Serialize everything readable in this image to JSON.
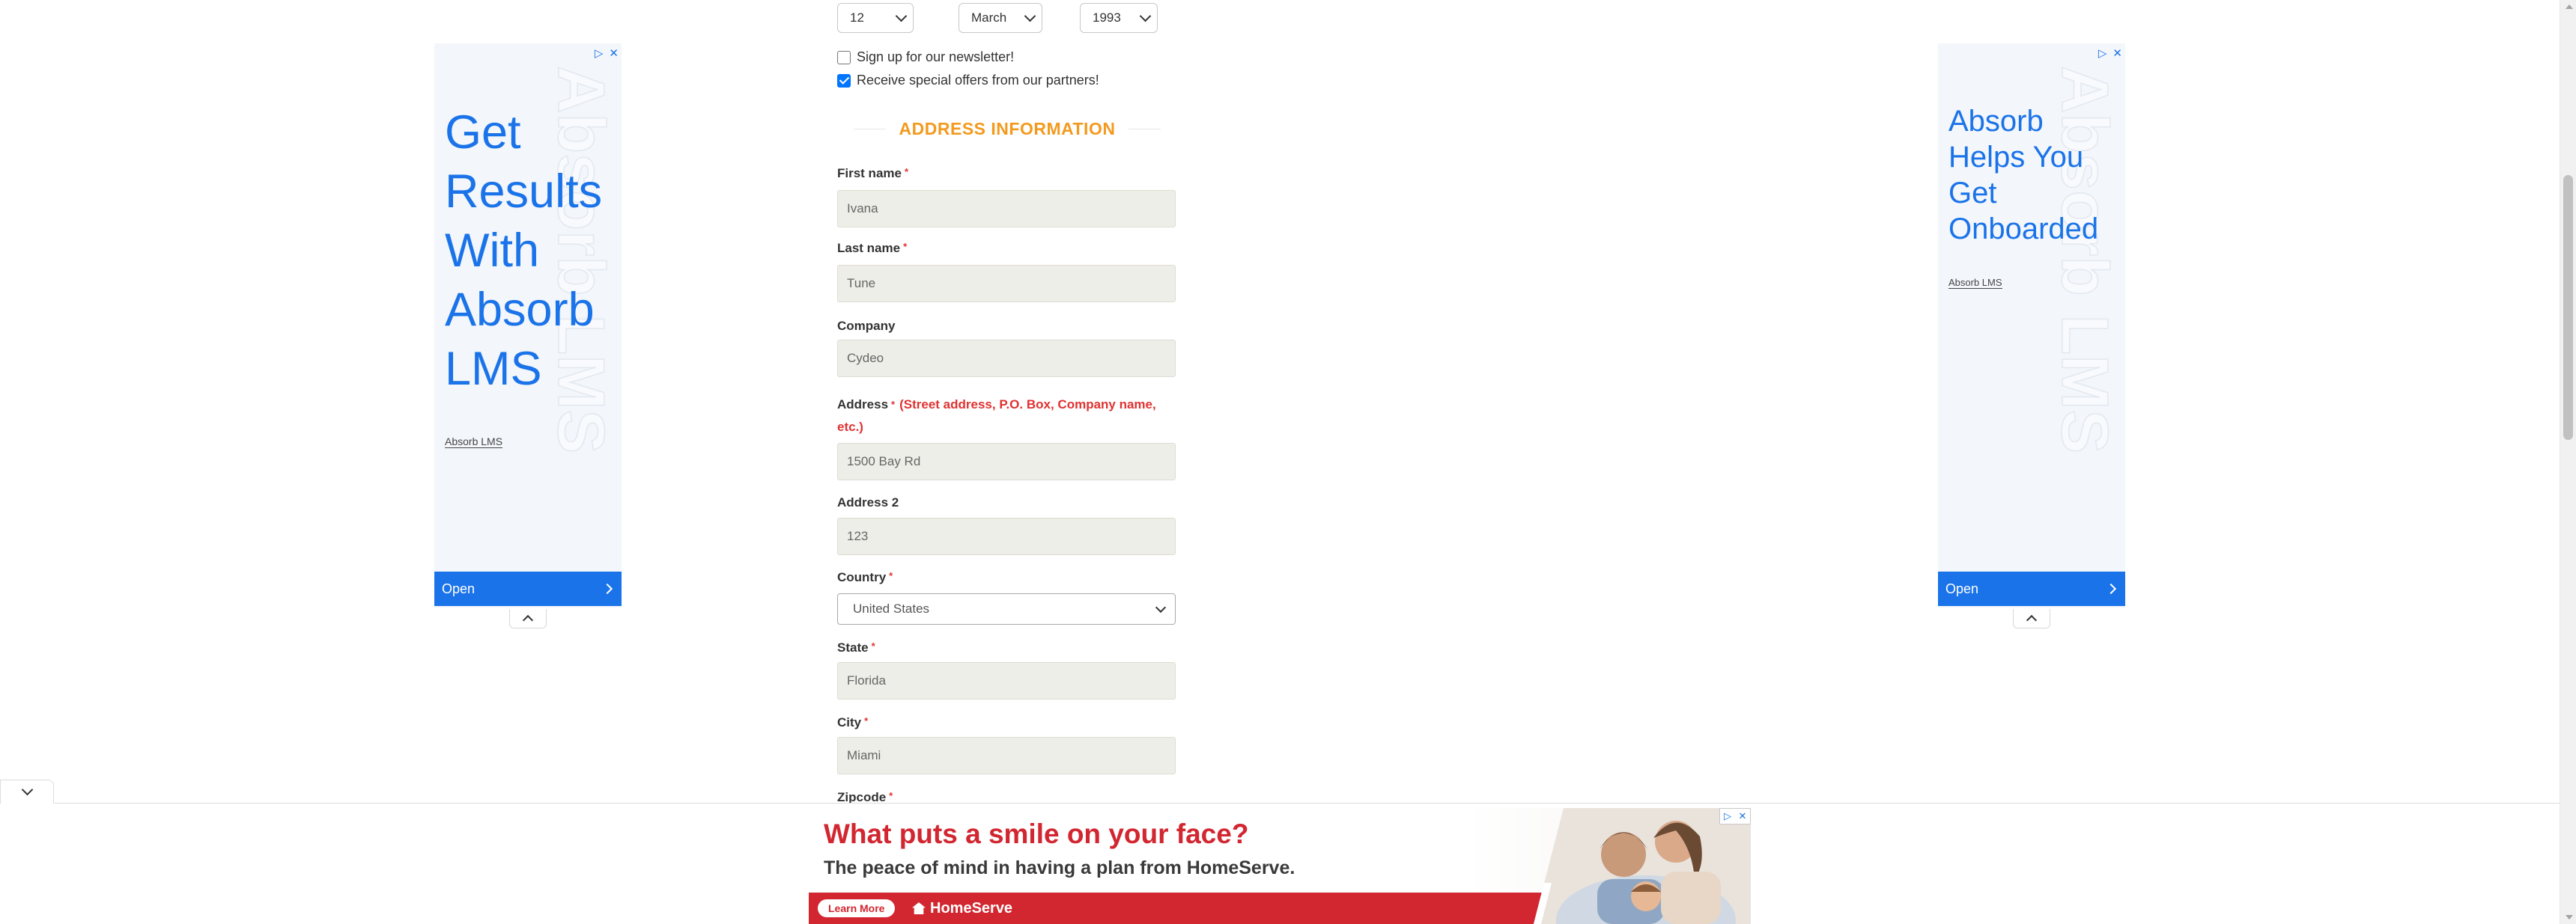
{
  "dob": {
    "day": "12",
    "month": "March",
    "year": "1993"
  },
  "checkboxes": {
    "newsletter": {
      "label": "Sign up for our newsletter!",
      "checked": false
    },
    "offers": {
      "label": "Receive special offers from our partners!",
      "checked": true
    }
  },
  "address_section": {
    "heading": "ADDRESS INFORMATION",
    "required_mark": "*",
    "first_name": {
      "label": "First name",
      "value": "Ivana"
    },
    "last_name": {
      "label": "Last name",
      "value": "Tune"
    },
    "company": {
      "label": "Company",
      "value": "Cydeo"
    },
    "address": {
      "label": "Address",
      "hint_line1": "(Street address, P.O. Box, Company name,",
      "hint_line2": "etc.)",
      "value": "1500 Bay Rd"
    },
    "address2": {
      "label": "Address 2",
      "value": "123"
    },
    "country": {
      "label": "Country",
      "value": "United States"
    },
    "state": {
      "label": "State",
      "value": "Florida"
    },
    "city": {
      "label": "City",
      "value": "Miami"
    },
    "zipcode": {
      "label": "Zipcode"
    }
  },
  "left_ad": {
    "headline": [
      "Get",
      "Results",
      "With",
      "Absorb",
      "LMS"
    ],
    "watermark": "Absorb LMS",
    "brand": "Absorb LMS",
    "open_label": "Open",
    "choices_icon": "ad-choices-icon",
    "close_icon": "close-icon"
  },
  "right_ad": {
    "headline": [
      "Absorb",
      "Helps You",
      "Get",
      "Onboarded"
    ],
    "watermark": "Absorb LMS",
    "brand": "Absorb LMS",
    "open_label": "Open"
  },
  "bottom_banner": {
    "headline": "What puts a smile on your face?",
    "subline": "The peace of mind in having a plan from HomeServe.",
    "cta": "Learn More",
    "logo": "HomeServe",
    "accent_color": "#d22630"
  },
  "colors": {
    "section_heading": "#f39a1e",
    "required": "#e03131",
    "ad_blue": "#1a73e8",
    "input_bg": "#eeeee8"
  }
}
